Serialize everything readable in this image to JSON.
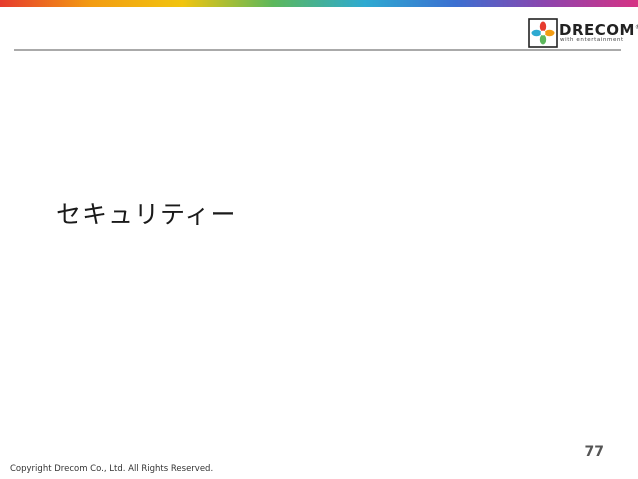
{
  "brand": {
    "logo_word": "DRECOM",
    "logo_registered": "®",
    "logo_tagline": "with entertainment",
    "colors": {
      "rule": "#aaaaaa",
      "bar_gradient": [
        "#e63b2e",
        "#f39c12",
        "#f1c40f",
        "#5cb85c",
        "#2eaad1",
        "#3b6fd1",
        "#8e44ad",
        "#d63384"
      ],
      "mark": [
        "#e63b2e",
        "#f39c12",
        "#5cb85c",
        "#2eaad1"
      ]
    }
  },
  "slide": {
    "title": "セキュリティー",
    "page_number": "77"
  },
  "footer": {
    "copyright": "Copyright Drecom Co., Ltd. All Rights Reserved."
  }
}
